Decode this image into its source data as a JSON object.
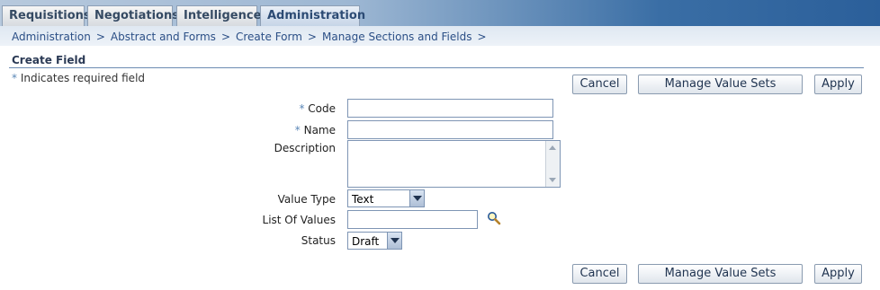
{
  "tabs": [
    {
      "label": "Requisitions"
    },
    {
      "label": "Negotiations"
    },
    {
      "label": "Intelligence"
    },
    {
      "label": "Administration",
      "active": true
    }
  ],
  "breadcrumbs": [
    {
      "label": "Administration"
    },
    {
      "label": "Abstract and Forms"
    },
    {
      "label": "Create Form"
    },
    {
      "label": "Manage Sections and Fields"
    }
  ],
  "breadcrumb_separator": ">",
  "page": {
    "title": "Create Field",
    "required_star": "*",
    "required_note": "Indicates required field"
  },
  "buttons": {
    "cancel": "Cancel",
    "manage_value_sets": "Manage Value Sets",
    "apply": "Apply"
  },
  "form": {
    "code": {
      "label": "Code",
      "value": "",
      "required": true
    },
    "name": {
      "label": "Name",
      "value": "",
      "required": true
    },
    "description": {
      "label": "Description",
      "value": ""
    },
    "value_type": {
      "label": "Value Type",
      "selected": "Text"
    },
    "list_of_values": {
      "label": "List Of Values",
      "value": ""
    },
    "status": {
      "label": "Status",
      "selected": "Draft"
    }
  },
  "colors": {
    "tab_bar_start": "#b7c9dd",
    "tab_bar_end": "#2b5f9a",
    "link": "#2b4f86",
    "required_star": "#5a86b6"
  },
  "icons": {
    "search": "magnifier-icon"
  }
}
